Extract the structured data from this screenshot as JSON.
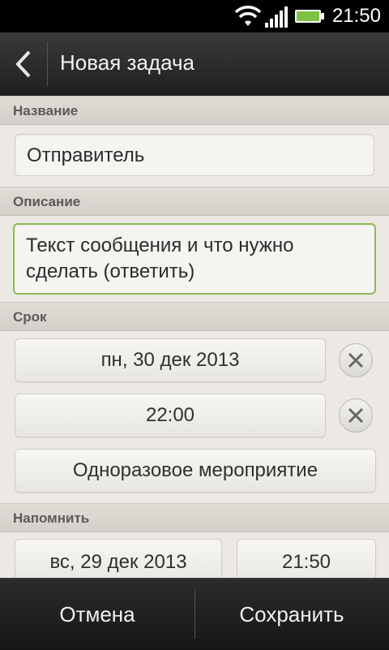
{
  "status": {
    "time": "21:50"
  },
  "header": {
    "title": "Новая задача"
  },
  "sections": {
    "name_label": "Название",
    "description_label": "Описание",
    "due_label": "Срок",
    "remind_label": "Напомнить"
  },
  "fields": {
    "name_value": "Отправитель",
    "description_value": "Текст сообщения и что нужно сделать (ответить)"
  },
  "due": {
    "date": "пн, 30 дек 2013",
    "time": "22:00",
    "repeat": "Одноразовое мероприятие"
  },
  "remind": {
    "date": "вс, 29 дек 2013",
    "time": "21:50"
  },
  "bottom": {
    "cancel": "Отмена",
    "save": "Сохранить"
  },
  "colors": {
    "accent_green": "#8fba55",
    "battery_green": "#7dc142"
  },
  "icons": [
    "wifi-icon",
    "signal-icon",
    "battery-icon",
    "back-arrow-icon",
    "clear-icon"
  ]
}
